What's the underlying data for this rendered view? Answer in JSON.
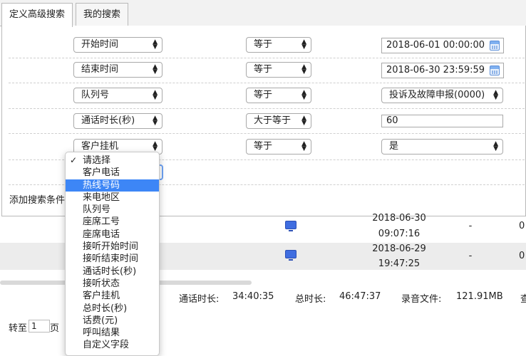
{
  "tabs": [
    {
      "label": "定义高级搜索",
      "active": true
    },
    {
      "label": "我的搜索",
      "active": false
    }
  ],
  "conditions": [
    {
      "field": "开始时间",
      "op": "等于",
      "value": "2018-06-01 00:00:00",
      "kind": "date"
    },
    {
      "field": "结束时间",
      "op": "等于",
      "value": "2018-06-30 23:59:59",
      "kind": "date"
    },
    {
      "field": "队列号",
      "op": "等于",
      "value": "投诉及故障申报(0000)",
      "kind": "select"
    },
    {
      "field": "通话时长(秒)",
      "op": "大于等于",
      "value": "60",
      "kind": "text"
    },
    {
      "field": "客户挂机",
      "op": "等于",
      "value": "是",
      "kind": "select"
    }
  ],
  "add_condition_label": "添加搜索条件",
  "table_rows": [
    {
      "date": "2018-06-30",
      "time": "09:07:16",
      "dash": "-",
      "extra": "0"
    },
    {
      "date": "2018-06-29",
      "time": "19:47:25",
      "dash": "-",
      "extra": "0"
    }
  ],
  "stats": {
    "call_duration_label": "通话时长:",
    "call_duration": "34:40:35",
    "total_duration_label": "总时长:",
    "total_duration": "46:47:37",
    "record_label": "录音文件:",
    "record_size": "121.91MB",
    "trailing": "查"
  },
  "pager": {
    "goto_label": "转至",
    "page_value": "1",
    "page_suffix": "页"
  },
  "dropdown": {
    "options": [
      "请选择",
      "客户电话",
      "热线号码",
      "来电地区",
      "队列号",
      "座席工号",
      "座席电话",
      "接听开始时间",
      "接听结束时间",
      "通话时长(秒)",
      "接听状态",
      "客户挂机",
      "总时长(秒)",
      "话费(元)",
      "呼叫结果",
      "自定义字段"
    ],
    "checked_index": 0,
    "highlighted_index": 2
  },
  "colors": {
    "highlight": "#3d86f6",
    "icon_blue": "#3f6de0"
  }
}
